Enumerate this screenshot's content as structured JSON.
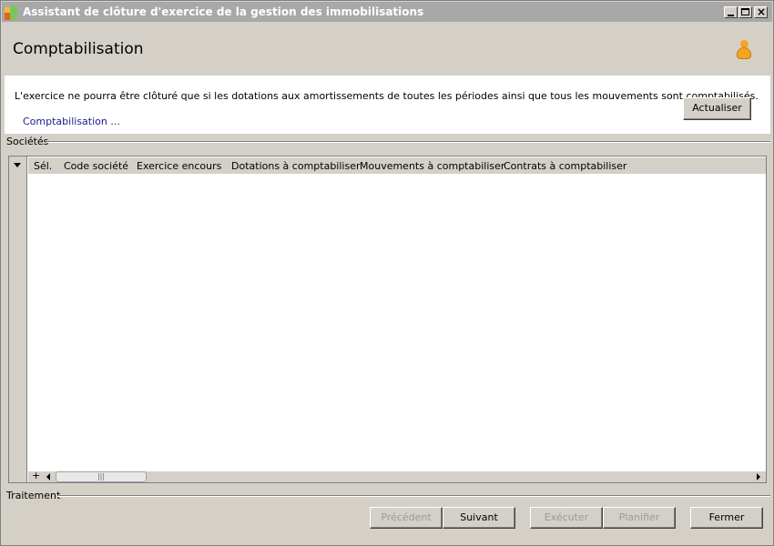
{
  "window": {
    "title": "Assistant de clôture d'exercice de la gestion des immobilisations"
  },
  "header": {
    "title": "Comptabilisation",
    "user_icon": "user-icon"
  },
  "info": {
    "message": "L'exercice ne pourra être clôturé que si les dotations aux amortissements de toutes les périodes ainsi que tous les mouvements sont comptabilisés.",
    "link": "Comptabilisation ...",
    "refresh_label": "Actualiser"
  },
  "societes": {
    "group_label": "Sociétés",
    "columns": [
      "Sél.",
      "Code société",
      "Exercice encours",
      "Dotations à comptabiliser",
      "Mouvements à comptabiliser",
      "Contrats à comptabiliser"
    ],
    "rows": [],
    "add_symbol": "+"
  },
  "traitement": {
    "group_label": "Traitement"
  },
  "buttons": {
    "previous": "Précédent",
    "next": "Suivant",
    "execute": "Exécuter",
    "plan": "Planifier",
    "close": "Fermer"
  }
}
